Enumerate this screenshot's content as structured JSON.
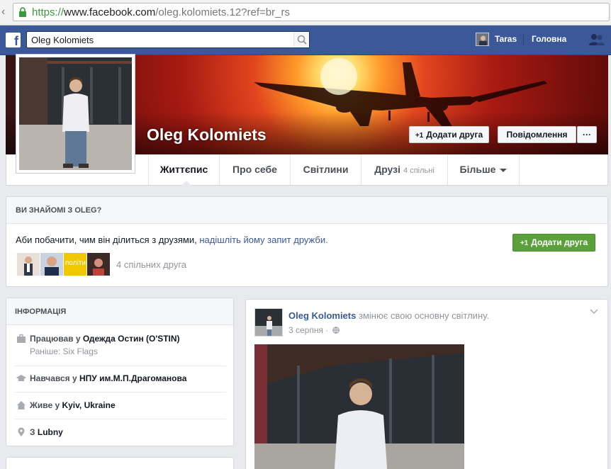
{
  "browser": {
    "url_protocol": "https://",
    "url_host": "www.facebook.com",
    "url_path": "/oleg.kolomiets.12?ref=br_rs"
  },
  "topbar": {
    "search_value": "Oleg Kolomiets",
    "user_name": "Taras",
    "home_label": "Головна"
  },
  "profile": {
    "name": "Oleg Kolomiets",
    "add_friend_label": "Додати друга",
    "add_friend_prefix": "+1",
    "message_label": "Повідомлення",
    "more_label": "···"
  },
  "tabs": [
    {
      "label": "Життєпис"
    },
    {
      "label": "Про себе"
    },
    {
      "label": "Світлини"
    },
    {
      "label": "Друзі",
      "count": "4 спільні"
    },
    {
      "label": "Більше"
    }
  ],
  "know_card": {
    "title": "ВИ ЗНАЙОМІ З OLEG?",
    "message": "Аби побачити, чим він ділиться з друзями, ",
    "link": "надішліть йому запит дружби.",
    "button_prefix": "+1",
    "button_label": "Додати друга",
    "mutual_text": "4 спільних друга",
    "mutual_thumb_text": "політи"
  },
  "info_card": {
    "title": "ІНФОРМАЦІЯ",
    "work_prefix": "Працював у ",
    "work_place": "Одежда Остин (O'STIN)",
    "work_previous": "Раніше: Six Flags",
    "study_prefix": "Навчався у ",
    "study_place": "НПУ им.М.П.Драгоманова",
    "lives_prefix": "Живе у ",
    "lives_place": "Kyiv, Ukraine",
    "from_prefix": "З ",
    "from_place": "Lubny"
  },
  "post": {
    "author": "Oleg Kolomiets",
    "action": "змінює свою основну світлину.",
    "date": "3 серпня",
    "separator": "·"
  },
  "colors": {
    "facebook_blue": "#3b5998",
    "green_button": "#5ba13b",
    "page_background": "#e9eaed"
  }
}
